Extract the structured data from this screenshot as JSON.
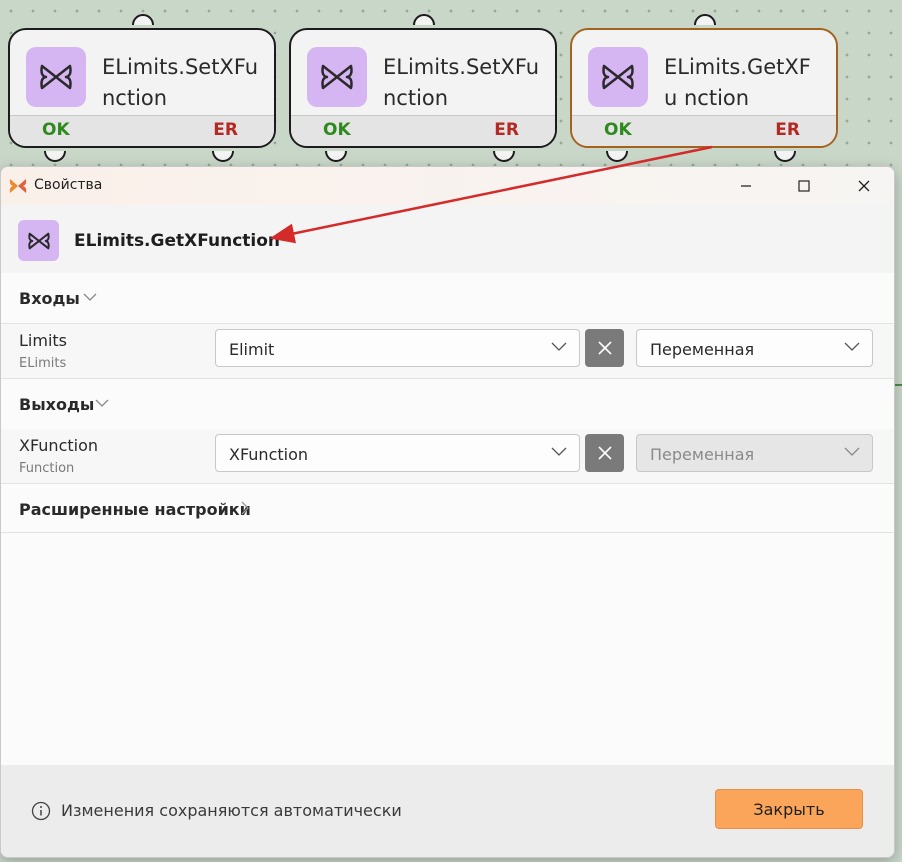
{
  "canvas": {
    "nodes": [
      {
        "title": "ELimits.SetXFu nction",
        "ok": "OK",
        "er": "ER",
        "selected": false
      },
      {
        "title": "ELimits.SetXFu nction",
        "ok": "OK",
        "er": "ER",
        "selected": false
      },
      {
        "title": "ELimits.GetXFu nction",
        "ok": "OK",
        "er": "ER",
        "selected": true
      }
    ]
  },
  "dialog": {
    "window_title": "Свойства",
    "header_title": "ELimits.GetXFunction",
    "inputs_section": "Входы",
    "input_row": {
      "name": "Limits",
      "type": "ELimits",
      "value": "Elimit",
      "mode": "Переменная"
    },
    "outputs_section": "Выходы",
    "output_row": {
      "name": "XFunction",
      "type": "Function",
      "value": "XFunction",
      "mode": "Переменная"
    },
    "advanced_section": "Расширенные настройки",
    "footer_info": "Изменения сохраняются автоматически",
    "close_label": "Закрыть"
  },
  "colors": {
    "accent_purple": "#d6b6f2",
    "ok_green": "#2e8a1e",
    "er_red": "#b42a22",
    "selected_border": "#a4621f",
    "close_button": "#fba55a",
    "annotation_arrow": "#d42a2a"
  },
  "icons": {
    "node_icon": "butterfly-icon",
    "app_icon": "butterfly-logo-icon",
    "info_icon": "info-icon"
  }
}
